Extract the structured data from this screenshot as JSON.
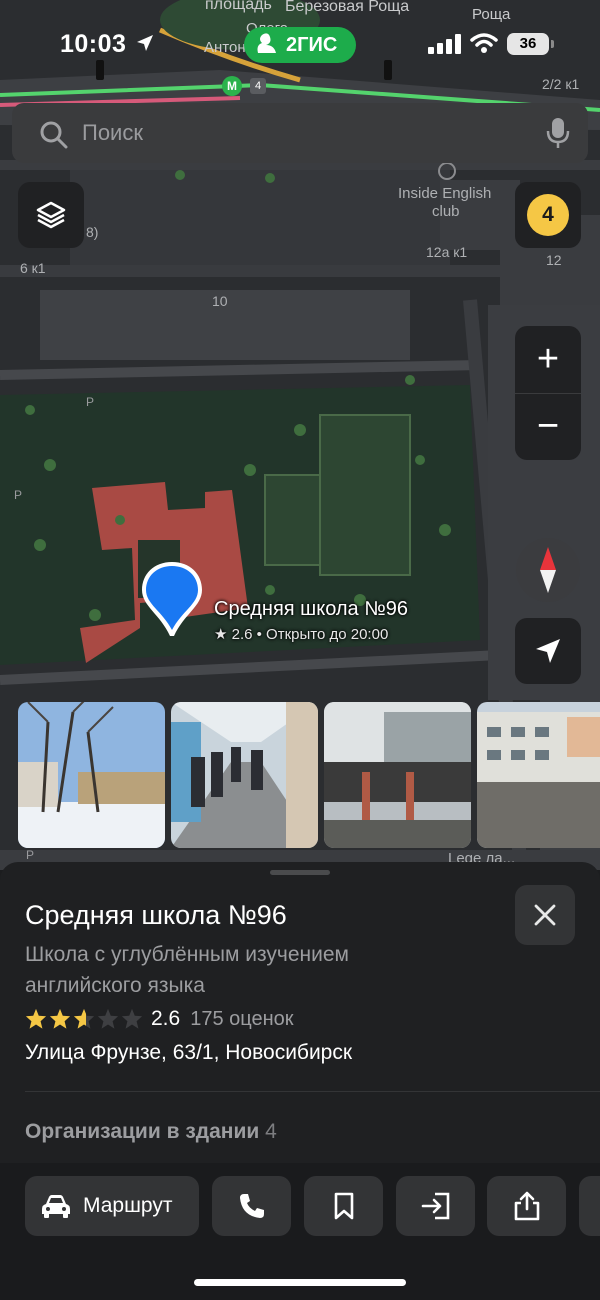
{
  "status_bar": {
    "time": "10:03",
    "battery": "36",
    "app_name": "2ГИС"
  },
  "search": {
    "placeholder": "Поиск"
  },
  "map": {
    "labels": {
      "square": "площадь",
      "birch": "Березовая Роща",
      "grove": "Роща",
      "oleg": "Олега",
      "anton": "Антон",
      "metro_exit": "4",
      "house_2_2": "2/2 к1",
      "inside_english": "Inside English",
      "club": "club",
      "house_12a": "12а к1",
      "house_12": "12",
      "house_10": "10",
      "house_6": "6 к1",
      "house_8": "8)",
      "legend_partial": "Lege ла...",
      "parking": "P"
    },
    "layers_icon": "layers-icon",
    "badge_count": "4",
    "zoom_in": "+",
    "zoom_out": "−",
    "poi": {
      "title": "Средняя школа №96",
      "subtitle": "★ 2.6 • Открыто до 20:00"
    }
  },
  "photos": [
    {
      "subject": "winter school exterior"
    },
    {
      "subject": "school corridor with students"
    },
    {
      "subject": "school entrance porch"
    },
    {
      "subject": "school building courtyard"
    }
  ],
  "place": {
    "title": "Средняя школа №96",
    "category": "Школа с углублённым изучением английского языка",
    "rating": 2.6,
    "rating_text": "2.6",
    "reviews": "175 оценок",
    "address": "Улица Фрунзе, 63/1, Новосибирск",
    "orgs_label": "Организации в здании",
    "orgs_count": "4"
  },
  "actions": {
    "route_label": "Маршрут",
    "icons": [
      "car-icon",
      "phone-icon",
      "bookmark-icon",
      "entrance-icon",
      "share-icon"
    ]
  },
  "colors": {
    "accent_green": "#1dac4b",
    "pin_blue": "#1a78f2",
    "star_yellow": "#f5c745",
    "building_red": "#a94a44"
  }
}
